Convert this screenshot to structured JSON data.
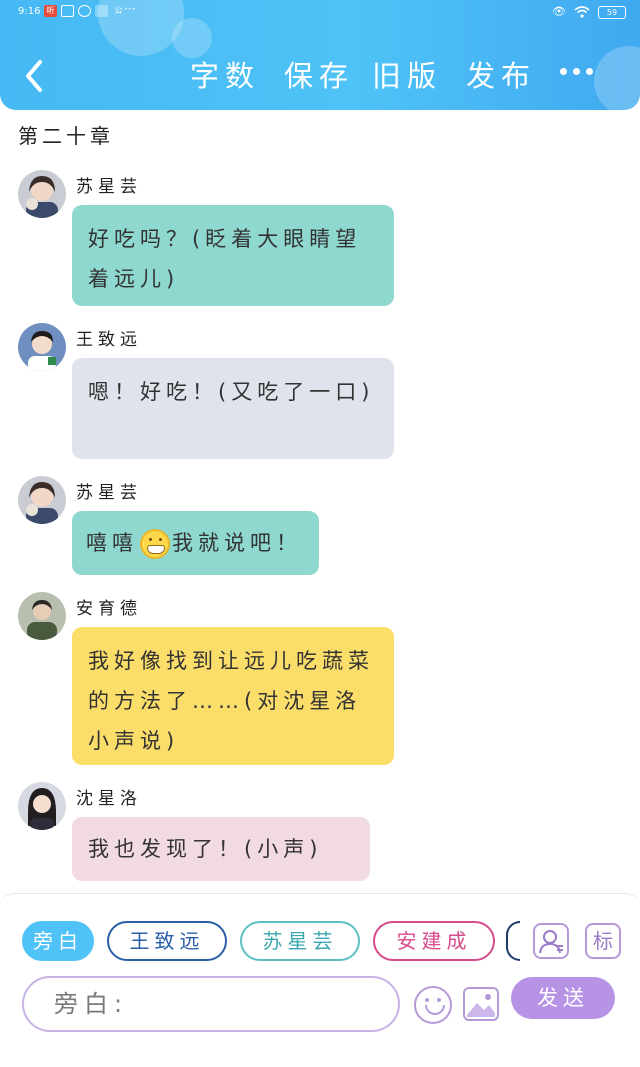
{
  "status_bar": {
    "time": "9:16",
    "app_icons": [
      "听",
      "",
      "",
      "",
      "公"
    ],
    "more_dots": "···",
    "battery": "59"
  },
  "header": {
    "actions": {
      "word_count": "字数",
      "save": "保存",
      "old_version": "旧版",
      "publish": "发布"
    }
  },
  "chapter": {
    "title": "第二十章"
  },
  "messages": [
    {
      "sender": "苏星芸",
      "text": "好吃吗？(眨着大眼睛望着远儿)"
    },
    {
      "sender": "王致远",
      "text": "嗯！好吃！(又吃了一口)"
    },
    {
      "sender": "苏星芸",
      "text_before": "嘻嘻",
      "text_after": "我就说吧！"
    },
    {
      "sender": "安育德",
      "text": "我好像找到让远儿吃蔬菜的方法了……(对沈星洛小声说)"
    },
    {
      "sender": "沈星洛",
      "text": "我也发现了！(小声)"
    }
  ],
  "composer": {
    "roles": [
      "旁白",
      "王致远",
      "苏星芸",
      "安建成"
    ],
    "tag_label": "标",
    "input_placeholder": "旁白:",
    "send_label": "发送"
  },
  "colors": {
    "header": "#4fc3f7",
    "bubble_teal": "#8fd8cf",
    "bubble_grey": "#dee3ec",
    "bubble_yellow": "#fbdd6a",
    "bubble_pink": "#f1dbe1",
    "send": "#b793e6"
  }
}
